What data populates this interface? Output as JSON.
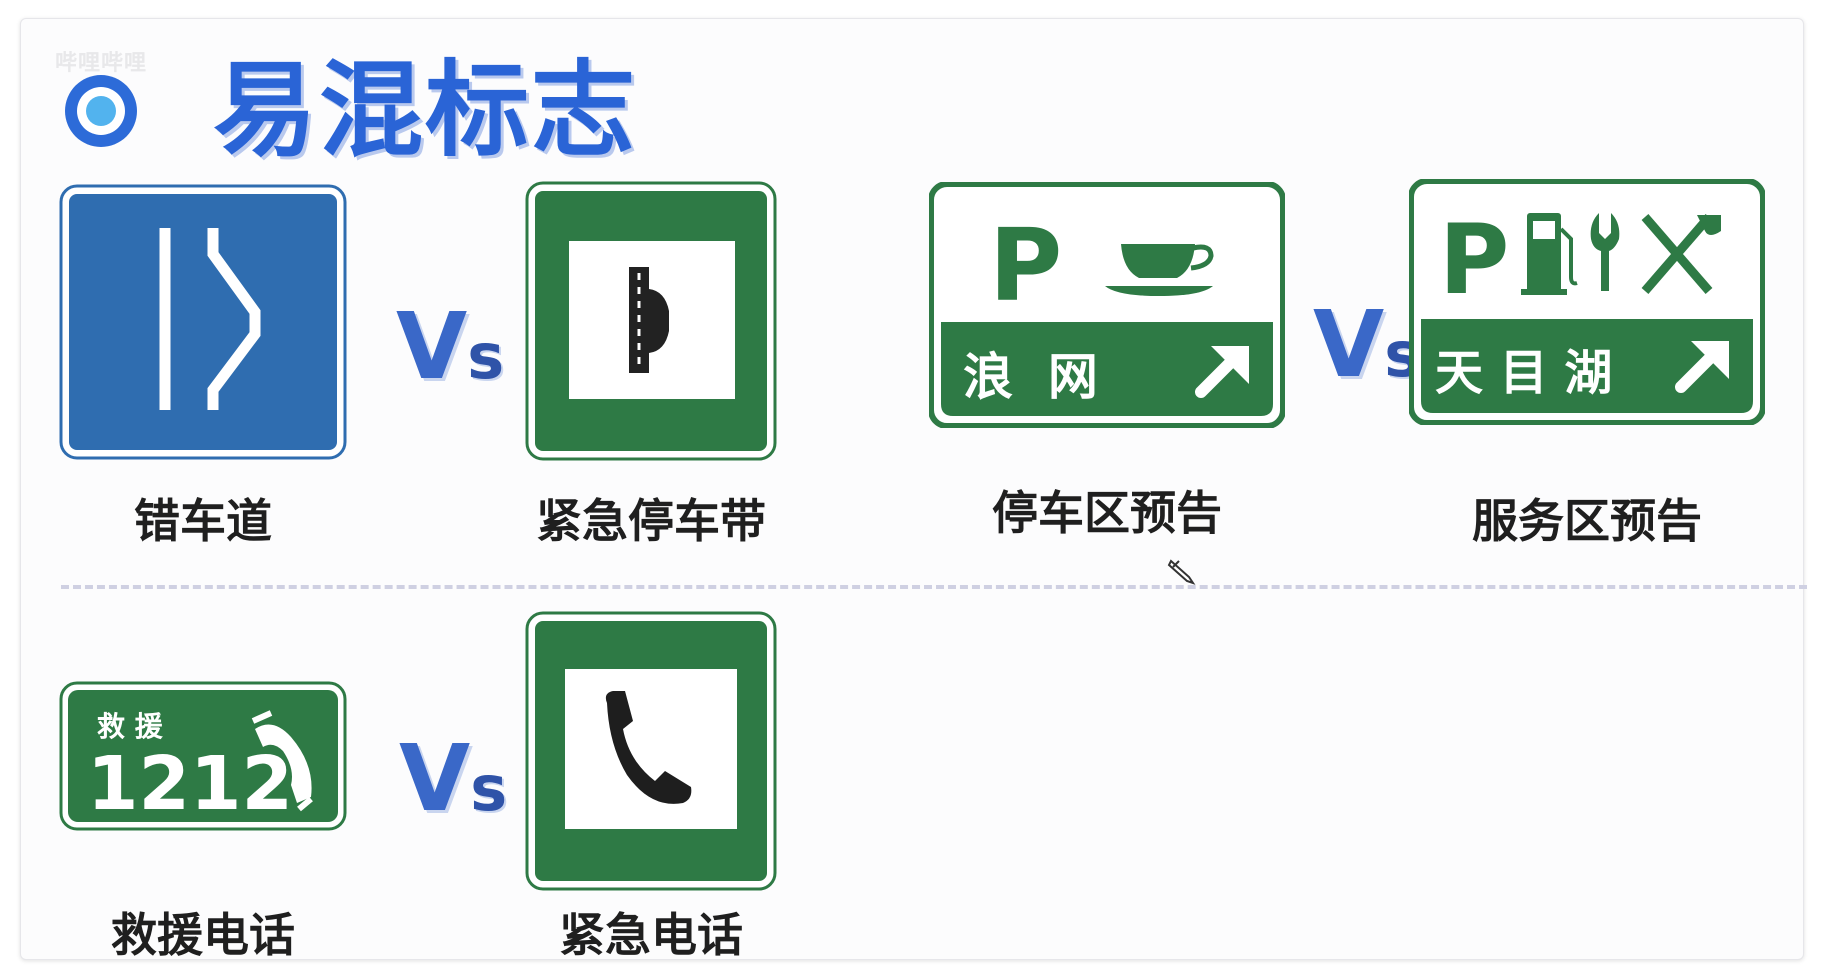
{
  "watermark": "哔哩哔哩",
  "title": "易混标志",
  "vs_label": {
    "v": "V",
    "s": "s"
  },
  "colors": {
    "sign_blue": "#2f6db0",
    "sign_green": "#2e7a45",
    "title_blue": "#2a64d6"
  },
  "row1": {
    "pair1": {
      "left": {
        "caption": "错车道",
        "icon": "passing-bay-sign"
      },
      "right": {
        "caption": "紧急停车带",
        "icon": "emergency-parking-strip-sign"
      }
    },
    "pair2": {
      "left": {
        "caption": "停车区预告",
        "icon": "parking-area-advance-sign",
        "sign_p": "P",
        "sign_place": "浪  网"
      },
      "right": {
        "caption": "服务区预告",
        "icon": "service-area-advance-sign",
        "sign_p": "P",
        "sign_place": "天 目 湖"
      }
    }
  },
  "row2": {
    "pair1": {
      "left": {
        "caption": "救援电话",
        "icon": "rescue-phone-sign",
        "sign_label": "救 援",
        "sign_number": "1212"
      },
      "right": {
        "caption": "紧急电话",
        "icon": "emergency-phone-sign"
      }
    }
  }
}
